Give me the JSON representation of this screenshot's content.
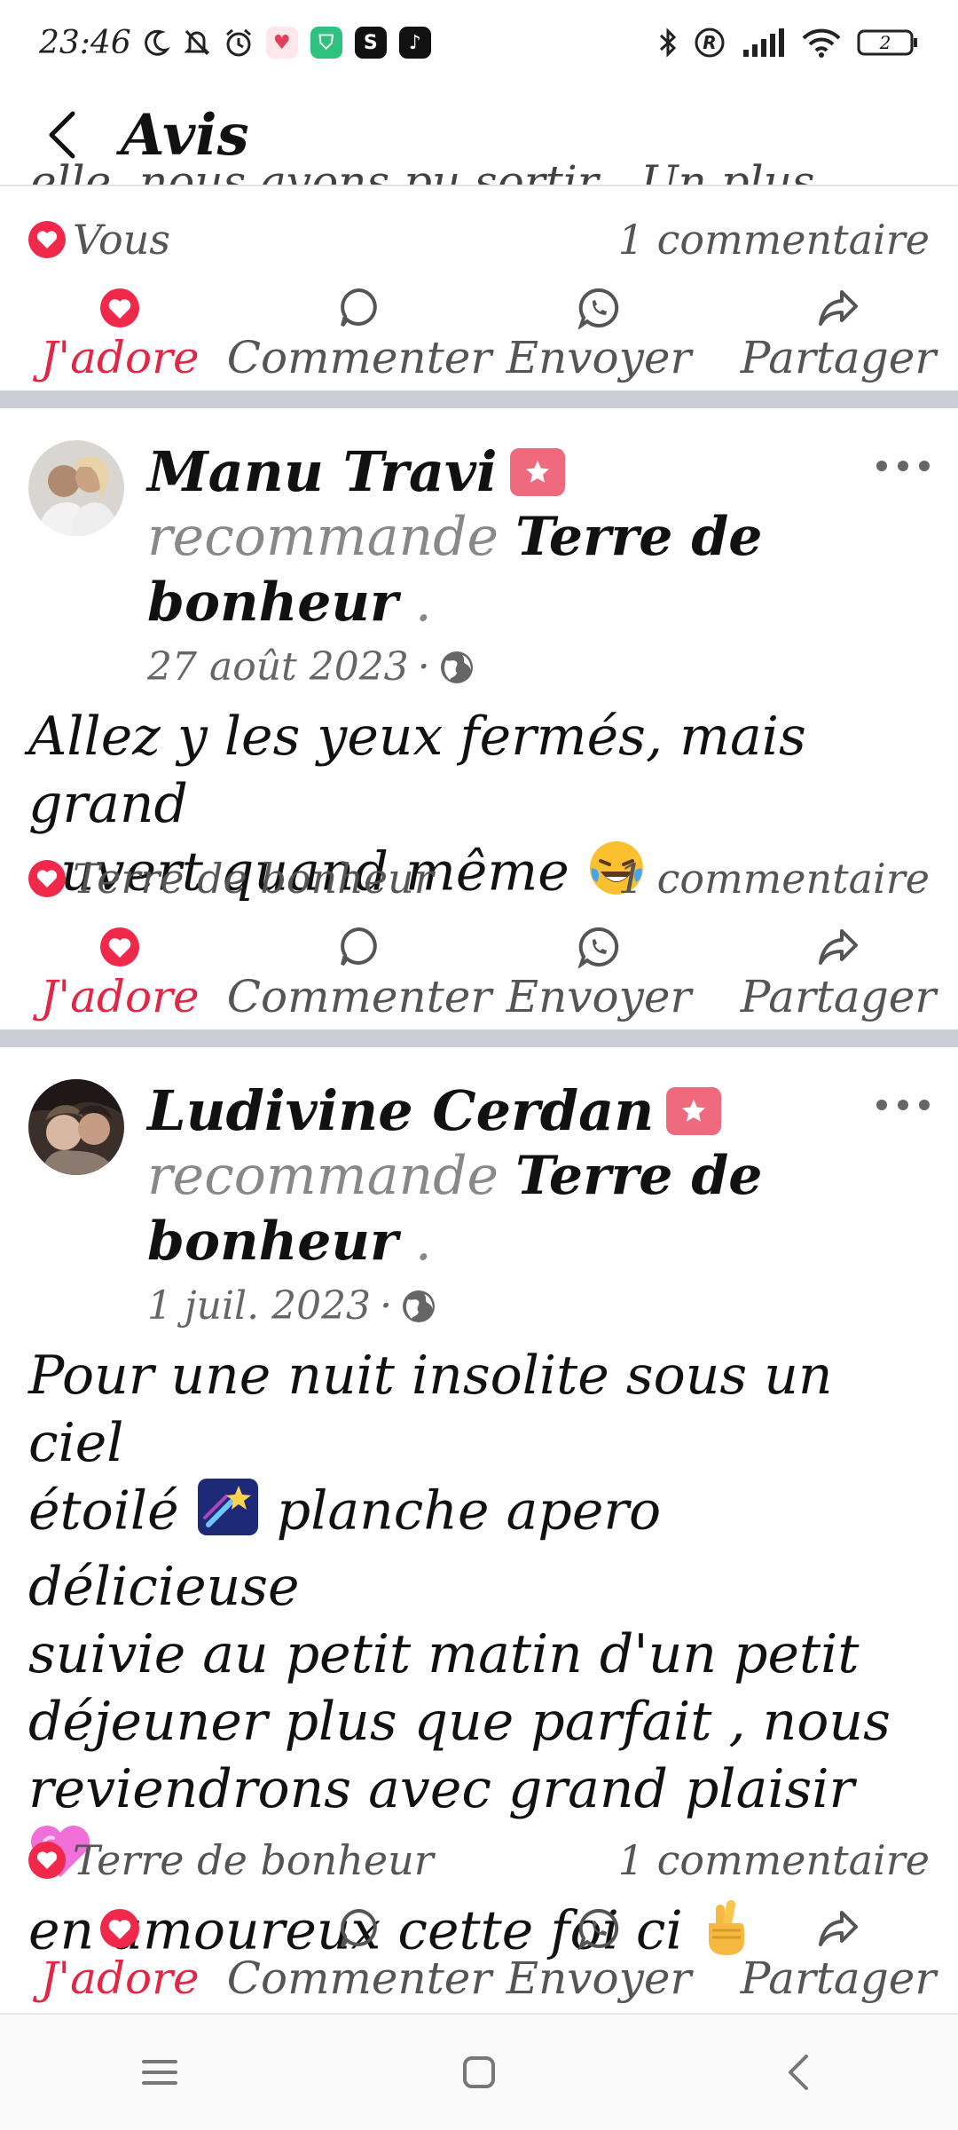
{
  "status_bar": {
    "time": "23:46",
    "icons_left": [
      "moon-icon",
      "bell-off-icon",
      "alarm-icon",
      "health-app-icon",
      "shield-app-icon",
      "s-app-icon",
      "tiktok-icon"
    ],
    "icons_right": [
      "bluetooth-icon",
      "registered-icon",
      "signal-icon",
      "wifi-icon",
      "battery-icon"
    ],
    "battery": "2"
  },
  "header": {
    "title": "Avis",
    "back_icon": "chevron-left-icon"
  },
  "clipped_prev_text": "elle, nous avons pu sortir . Un plus",
  "posts": [
    {
      "stats": {
        "reactor": "Vous",
        "comments": "1 commentaire"
      },
      "actions": {
        "love": "J'adore",
        "comment": "Commenter",
        "send": "Envoyer",
        "share": "Partager"
      }
    },
    {
      "author": "Manu Travi",
      "recommend_word": "recommande",
      "place": "Terre de bonheur",
      "dot": ".",
      "date": "27 août 2023",
      "body_line1": "Allez y les yeux fermés, mais grand",
      "body_line2": "ouvert quand même",
      "body_emoji": "laughing-emoji",
      "stats": {
        "reactor": "Terre de bonheur",
        "comments": "1 commentaire"
      },
      "actions": {
        "love": "J'adore",
        "comment": "Commenter",
        "send": "Envoyer",
        "share": "Partager"
      }
    },
    {
      "author": "Ludivine Cerdan",
      "recommend_word": "recommande",
      "place": "Terre de bonheur",
      "dot": ".",
      "date": "1 juil. 2023",
      "body_l1": "Pour une nuit insolite sous un ciel",
      "body_l2a": "étoilé",
      "body_l2b": "planche apero délicieuse",
      "body_l3": "suivie au petit matin d'un petit",
      "body_l4": "déjeuner plus que parfait , nous",
      "body_l5": "reviendrons avec grand plaisir",
      "body_l6": "en amoureux cette foi ci",
      "stats": {
        "reactor": "Terre de bonheur",
        "comments": "1 commentaire"
      },
      "actions": {
        "love": "J'adore",
        "comment": "Commenter",
        "send": "Envoyer",
        "share": "Partager"
      }
    }
  ],
  "colors": {
    "accent": "#e02746",
    "love": "#f0284a",
    "separator": "#ccced6",
    "badge": "#f06a7d"
  },
  "nav": [
    "menu-icon",
    "home-square-icon",
    "back-triangle-icon"
  ]
}
